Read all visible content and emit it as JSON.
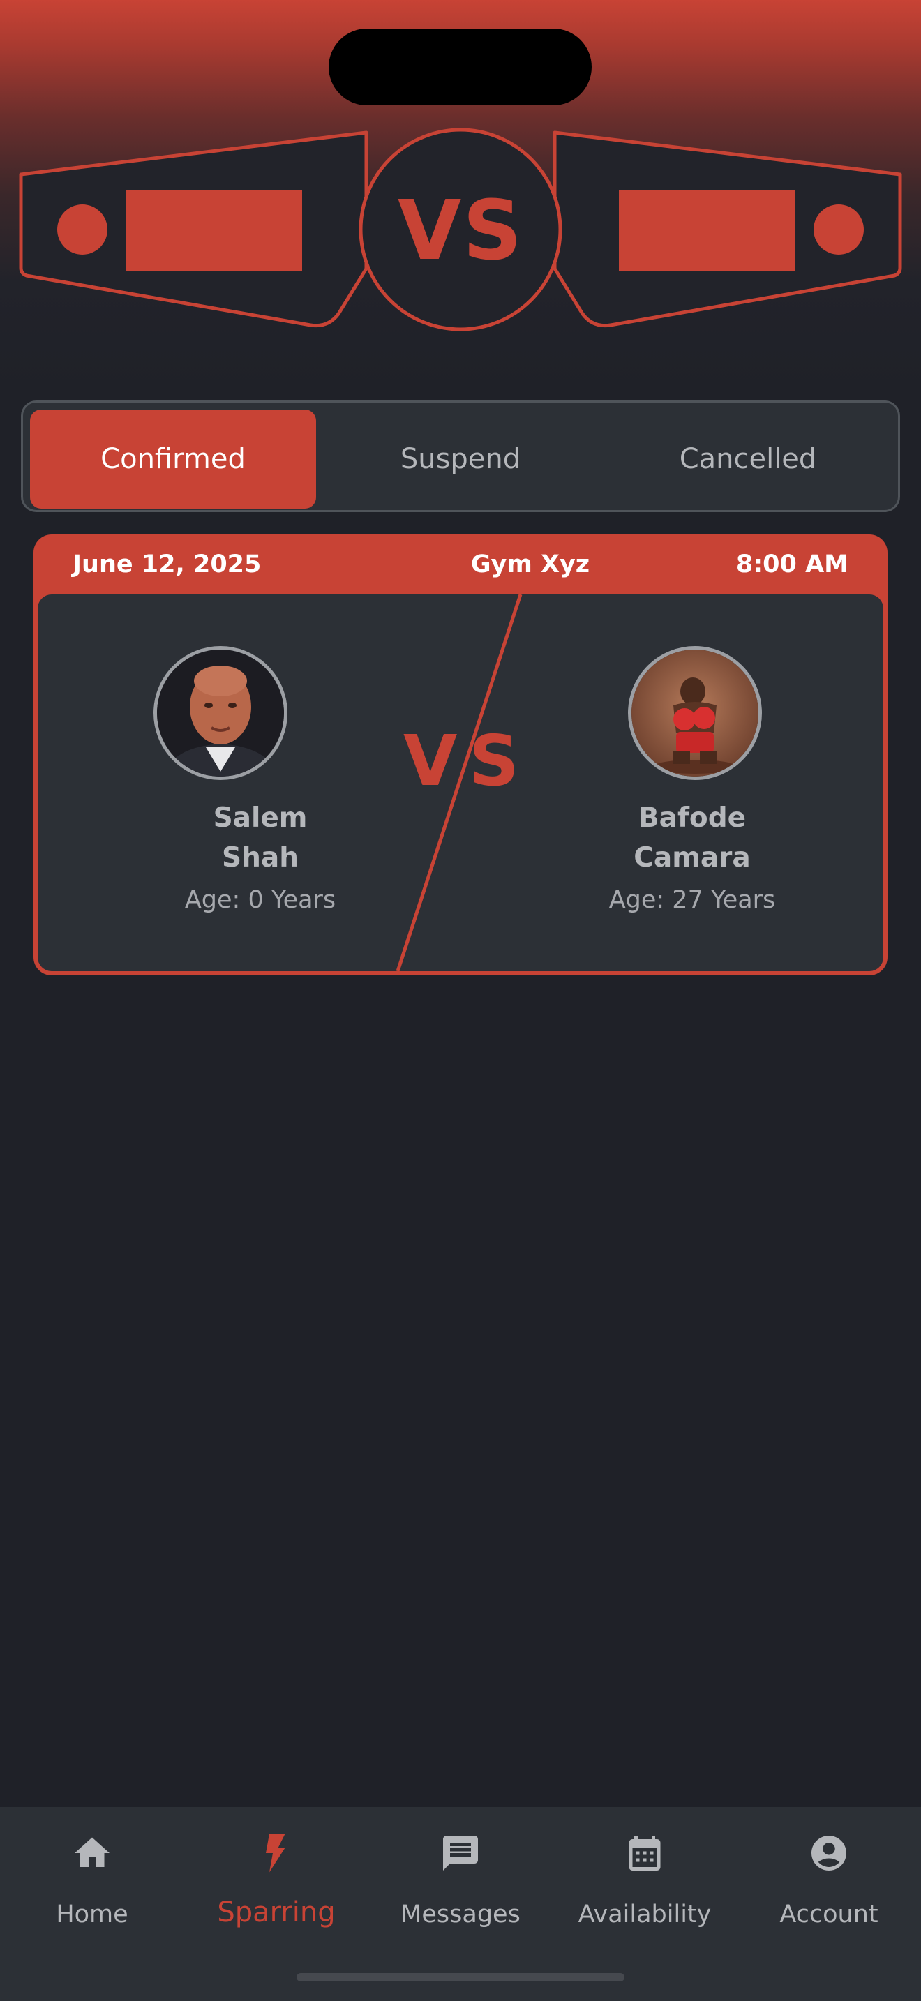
{
  "header": {
    "vs_label": "VS"
  },
  "tabs": [
    {
      "label": "Confirmed",
      "active": true
    },
    {
      "label": "Suspend",
      "active": false
    },
    {
      "label": "Cancelled",
      "active": false
    }
  ],
  "match_card": {
    "date": "June 12, 2025",
    "gym": "Gym Xyz",
    "time": "8:00 AM",
    "vs_left": "V",
    "vs_right": "S",
    "fighter_left": {
      "name_line1": "Salem",
      "name_line2": "Shah",
      "age": "Age: 0 Years"
    },
    "fighter_right": {
      "name_line1": "Bafode",
      "name_line2": "Camara",
      "age": "Age: 27 Years"
    }
  },
  "bottom_nav": {
    "items": [
      {
        "label": "Home",
        "icon": "home-icon"
      },
      {
        "label": "Sparring",
        "icon": "lightning-icon",
        "active": true
      },
      {
        "label": "Messages",
        "icon": "message-icon"
      },
      {
        "label": "Availability",
        "icon": "calendar-icon"
      },
      {
        "label": "Account",
        "icon": "account-circle-icon"
      }
    ]
  },
  "colors": {
    "accent": "#c84335",
    "background": "#1f2128",
    "surface": "#2c3036",
    "text_muted": "#b5b7bb"
  }
}
